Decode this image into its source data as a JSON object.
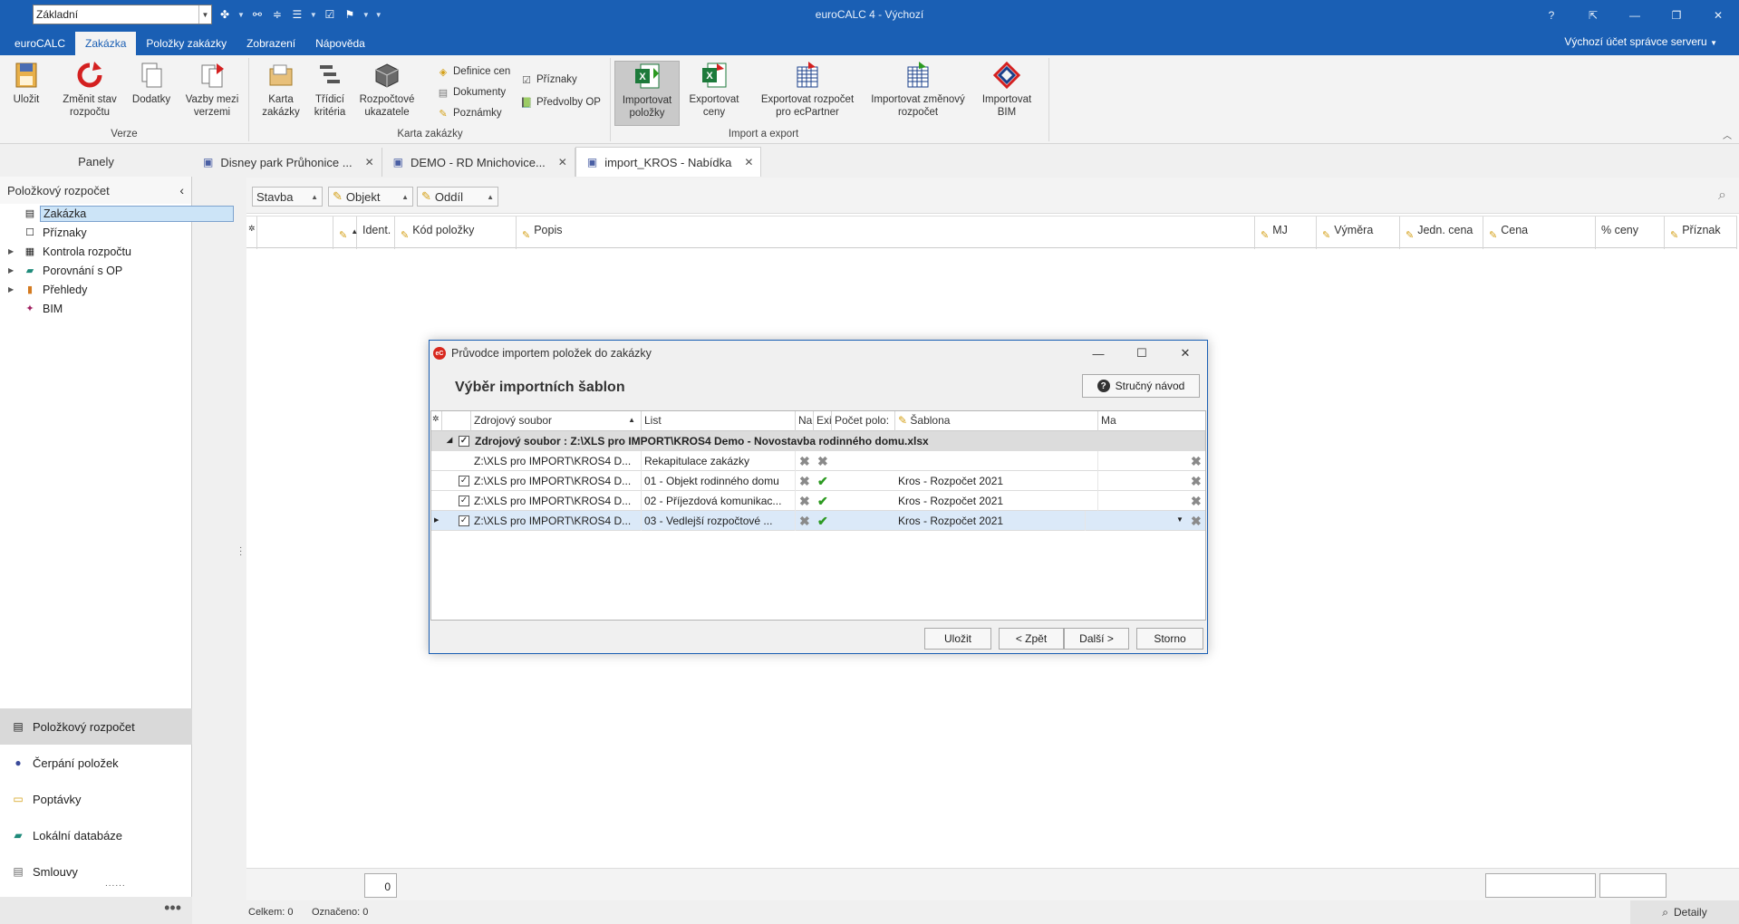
{
  "titlebar": {
    "view_combo": "Základní",
    "app_title": "euroCALC 4 - Výchozí",
    "controls": [
      "?",
      "⇱",
      "—",
      "❐",
      "✕"
    ]
  },
  "menubar": {
    "tabs": [
      "euroCALC",
      "Zakázka",
      "Položky zakázky",
      "Zobrazení",
      "Nápověda"
    ],
    "active_tab": "Zakázka",
    "account": "Výchozí účet správce serveru"
  },
  "ribbon": {
    "groups": {
      "verze": "Verze",
      "karta": "Karta zakázky",
      "import": "Import a export"
    },
    "buttons": {
      "ulozit": "Uložit",
      "zmenit": "Změnit stav rozpočtu",
      "dodatky": "Dodatky",
      "vazby": "Vazby mezi verzemi",
      "karta": "Karta zakázky",
      "tridici": "Třídicí kritéria",
      "rozpoctove": "Rozpočtové ukazatele",
      "definice": "Definice cen",
      "dokumenty": "Dokumenty",
      "poznamky": "Poznámky",
      "priznaky": "Příznaky",
      "predvolby": "Předvolby OP",
      "import_polozky": "Importovat položky",
      "export_ceny": "Exportovat ceny",
      "export_ecpartner": "Exportovat rozpočet pro ecPartner",
      "import_zmenovy": "Importovat změnový rozpočet",
      "import_bim": "Importovat BIM"
    }
  },
  "panels_label": "Panely",
  "doc_tabs": [
    {
      "label": "Disney park Průhonice ...",
      "active": false
    },
    {
      "label": "DEMO - RD Mnichovice...",
      "active": false
    },
    {
      "label": "import_KROS - Nabídka",
      "active": true
    }
  ],
  "left_pane": {
    "header": "Položkový rozpočet",
    "tree": [
      {
        "label": "Zakázka",
        "icon": "table-icon",
        "expandable": false,
        "selected": true
      },
      {
        "label": "Příznaky",
        "icon": "flag-icon",
        "expandable": false,
        "selected": false
      },
      {
        "label": "Kontrola rozpočtu",
        "icon": "grid-icon",
        "expandable": true,
        "selected": false
      },
      {
        "label": "Porovnání s OP",
        "icon": "book-icon",
        "expandable": true,
        "selected": false
      },
      {
        "label": "Přehledy",
        "icon": "chart-icon",
        "expandable": true,
        "selected": false
      },
      {
        "label": "BIM",
        "icon": "bim-icon",
        "expandable": false,
        "selected": false
      }
    ],
    "nav_buttons": [
      "Položkový rozpočet",
      "Čerpání položek",
      "Poptávky",
      "Lokální databáze",
      "Smlouvy"
    ],
    "nav_more": "•••"
  },
  "filters": [
    "Stavba",
    "Objekt",
    "Oddíl"
  ],
  "grid_headers": [
    "Ident.",
    "Kód položky",
    "Popis",
    "MJ",
    "Výměra",
    "Jedn. cena",
    "Cena",
    "% ceny",
    "Příznak"
  ],
  "status": {
    "field_value": "0",
    "celkem": "Celkem: 0",
    "oznaceno": "Označeno: 0",
    "detaily": "Detaily"
  },
  "dialog": {
    "title": "Průvodce importem položek do zakázky",
    "logo": "eC",
    "heading": "Výběr importních šablon",
    "help_button": "Stručný návod",
    "columns": [
      "Zdrojový soubor",
      "List",
      "Na",
      "Exi",
      "Počet polo:",
      "Šablona",
      "Ma"
    ],
    "group_row": "Zdrojový soubor : Z:\\XLS pro IMPORT\\KROS4 Demo - Novostavba rodinného domu.xlsx",
    "rows": [
      {
        "soubor": "Z:\\XLS pro IMPORT\\KROS4 D...",
        "list": "Rekapitulace zakázky",
        "checked": false,
        "exists": false,
        "sablona": "",
        "selected": false
      },
      {
        "soubor": "Z:\\XLS pro IMPORT\\KROS4 D...",
        "list": "01 - Objekt rodinného domu",
        "checked": true,
        "exists": true,
        "sablona": "Kros - Rozpočet 2021",
        "selected": false
      },
      {
        "soubor": "Z:\\XLS pro IMPORT\\KROS4 D...",
        "list": "02 - Příjezdová komunikac...",
        "checked": true,
        "exists": true,
        "sablona": "Kros - Rozpočet 2021",
        "selected": false
      },
      {
        "soubor": "Z:\\XLS pro IMPORT\\KROS4 D...",
        "list": "03 - Vedlejší rozpočtové ...",
        "checked": true,
        "exists": true,
        "sablona": "Kros - Rozpočet 2021",
        "selected": true
      }
    ],
    "buttons": [
      "Uložit",
      "< Zpět",
      "Další >",
      "Storno"
    ]
  }
}
